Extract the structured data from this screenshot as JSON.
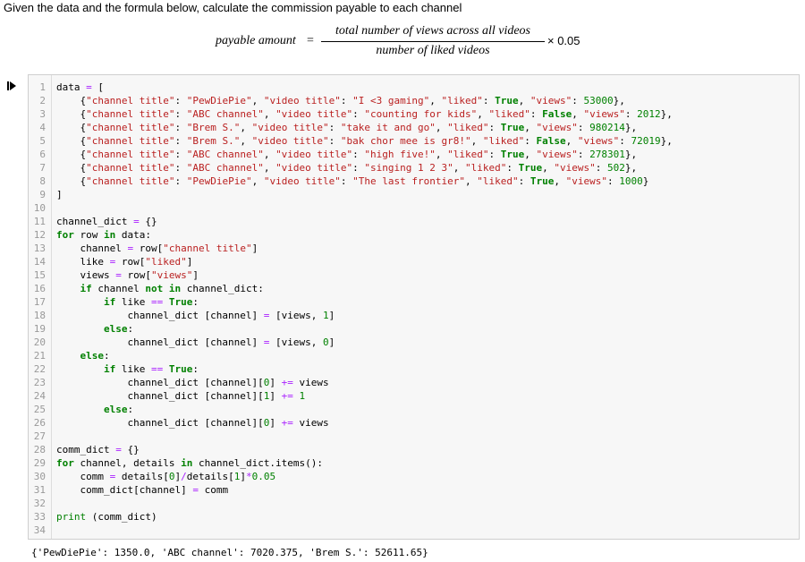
{
  "intro": "Given the data and the formula below, calculate the commission payable to each channel",
  "formula": {
    "lhs": "payable amount",
    "eq": "=",
    "numerator": "total number of views across all videos",
    "denominator": "number of liked videos",
    "multiplier": "× 0.05"
  },
  "code_lines": [
    "data = [",
    "    {\"channel title\": \"PewDiePie\", \"video title\": \"I <3 gaming\", \"liked\": True, \"views\": 53000},",
    "    {\"channel title\": \"ABC channel\", \"video title\": \"counting for kids\", \"liked\": False, \"views\": 2012},",
    "    {\"channel title\": \"Brem S.\", \"video title\": \"take it and go\", \"liked\": True, \"views\": 980214},",
    "    {\"channel title\": \"Brem S.\", \"video title\": \"bak chor mee is gr8!\", \"liked\": False, \"views\": 72019},",
    "    {\"channel title\": \"ABC channel\", \"video title\": \"high five!\", \"liked\": True, \"views\": 278301},",
    "    {\"channel title\": \"ABC channel\", \"video title\": \"singing 1 2 3\", \"liked\": True, \"views\": 502},",
    "    {\"channel title\": \"PewDiePie\", \"video title\": \"The last frontier\", \"liked\": True, \"views\": 1000}",
    "]",
    "",
    "channel_dict = {}",
    "for row in data:",
    "    channel = row[\"channel title\"]",
    "    like = row[\"liked\"]",
    "    views = row[\"views\"]",
    "    if channel not in channel_dict:",
    "        if like == True:",
    "            channel_dict [channel] = [views, 1]",
    "        else:",
    "            channel_dict [channel] = [views, 0]",
    "    else:",
    "        if like == True:",
    "            channel_dict [channel][0] += views",
    "            channel_dict [channel][1] += 1",
    "        else:",
    "            channel_dict [channel][0] += views",
    "",
    "comm_dict = {}",
    "for channel, details in channel_dict.items():",
    "    comm = details[0]/details[1]*0.05",
    "    comm_dict[channel] = comm",
    "",
    "print (comm_dict)",
    ""
  ],
  "line_numbers": [
    "1",
    "2",
    "3",
    "4",
    "5",
    "6",
    "7",
    "8",
    "9",
    "10",
    "11",
    "12",
    "13",
    "14",
    "15",
    "16",
    "17",
    "18",
    "19",
    "20",
    "21",
    "22",
    "23",
    "24",
    "25",
    "26",
    "27",
    "28",
    "29",
    "30",
    "31",
    "32",
    "33",
    "34"
  ],
  "output": "{'PewDiePie': 1350.0, 'ABC channel': 7020.375, 'Brem S.': 52611.65}",
  "colors": {
    "keyword": "#008000",
    "string": "#ba2121",
    "operator": "#aa22ff",
    "cell_bg": "#f7f7f7",
    "cell_border": "#cfcfcf"
  },
  "icons": {
    "run": "run-cell-icon"
  }
}
